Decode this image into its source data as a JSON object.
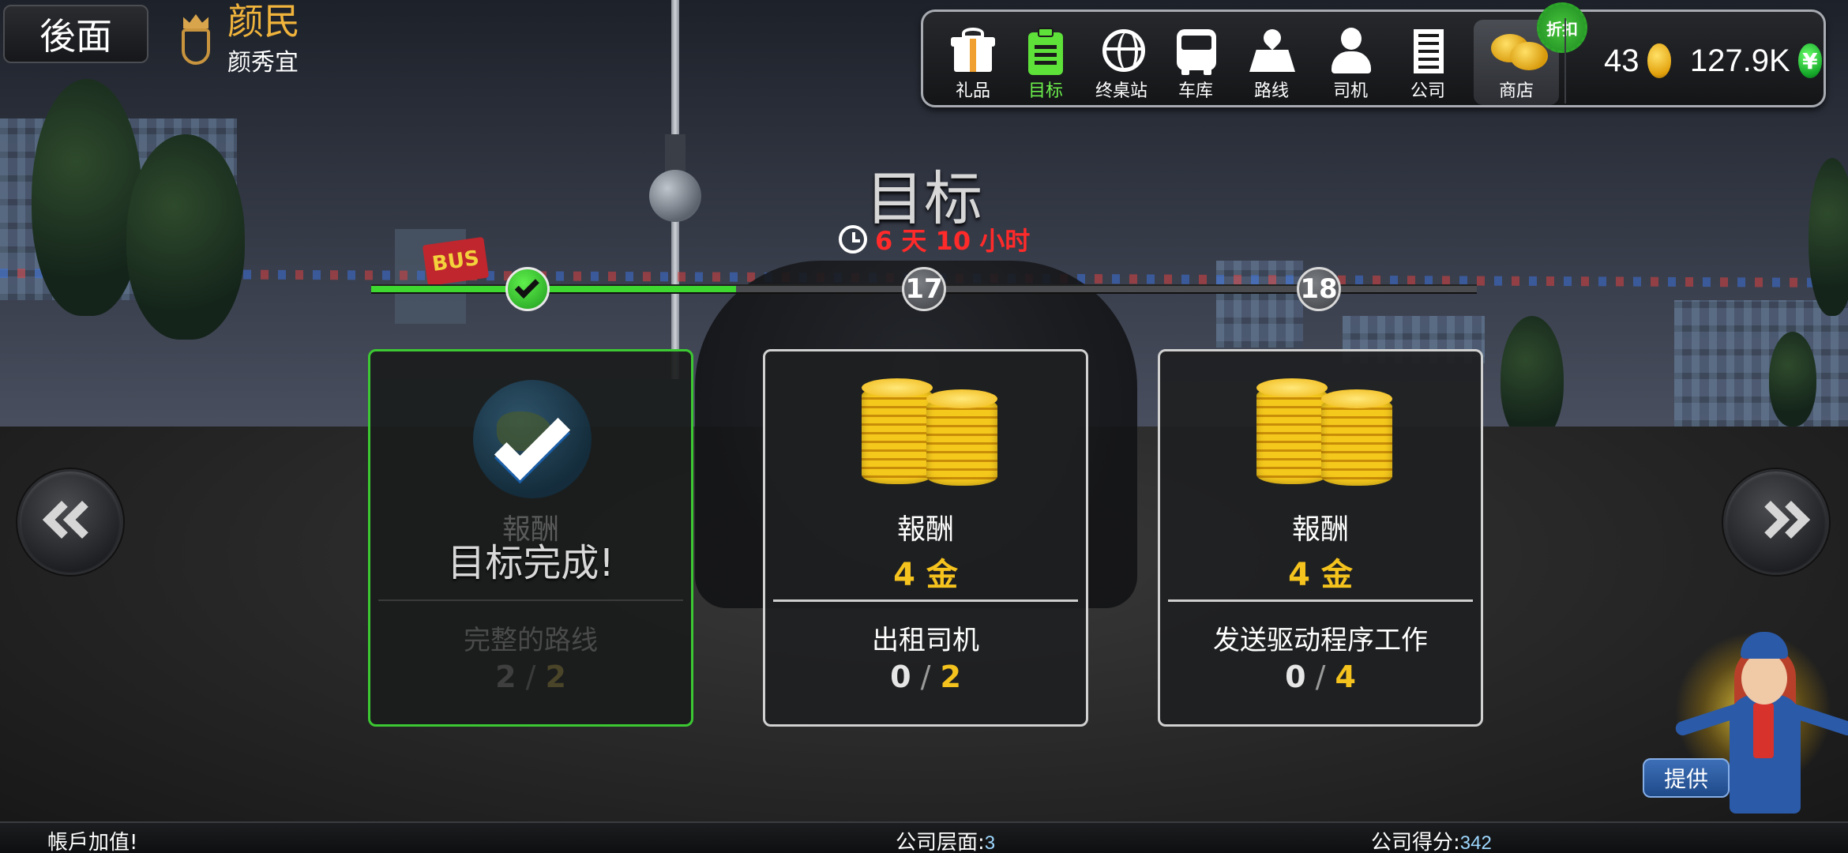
{
  "header": {
    "back_label": "後面",
    "player_name": "颜民",
    "player_sub": "颜秀宜"
  },
  "menu": {
    "items": [
      {
        "label": "礼品",
        "icon": "gift-icon"
      },
      {
        "label": "目标",
        "icon": "clipboard-icon",
        "active": true
      },
      {
        "label": "终桌站",
        "icon": "globe-icon"
      },
      {
        "label": "车库",
        "icon": "bus-icon"
      },
      {
        "label": "路线",
        "icon": "map-pin-icon"
      },
      {
        "label": "司机",
        "icon": "driver-icon"
      },
      {
        "label": "公司",
        "icon": "building-icon"
      },
      {
        "label": "商店",
        "icon": "coins-icon"
      }
    ],
    "discount_badge": "折扣",
    "gold": "43",
    "cash": "127.9K",
    "cash_symbol": "¥"
  },
  "objectives": {
    "title": "目标",
    "timer": "6 天 10 小时",
    "progress_fraction": 0.33,
    "nodes": [
      "✓",
      "17",
      "18"
    ],
    "cards": [
      {
        "status": "complete",
        "reward_label": "報酬",
        "complete_text": "目标完成!",
        "goal": "完整的路线",
        "current": "2",
        "target": "2"
      },
      {
        "status": "active",
        "reward_label": "報酬",
        "reward_value": "4 金",
        "goal": "出租司机",
        "current": "0",
        "target": "2"
      },
      {
        "status": "active",
        "reward_label": "報酬",
        "reward_value": "4 金",
        "goal": "发送驱动程序工作",
        "current": "0",
        "target": "4"
      }
    ]
  },
  "assistant": {
    "offer_label": "提供"
  },
  "footer": {
    "left_text": "帳戶加值!",
    "company_level_label": "公司层面:",
    "company_level": "3",
    "company_score_label": "公司得分:",
    "company_score": "342"
  },
  "colors": {
    "accent_green": "#3ed830",
    "gold": "#f5c31e",
    "timer_red": "#ff2a2a",
    "player_name": "#f0b43c"
  }
}
